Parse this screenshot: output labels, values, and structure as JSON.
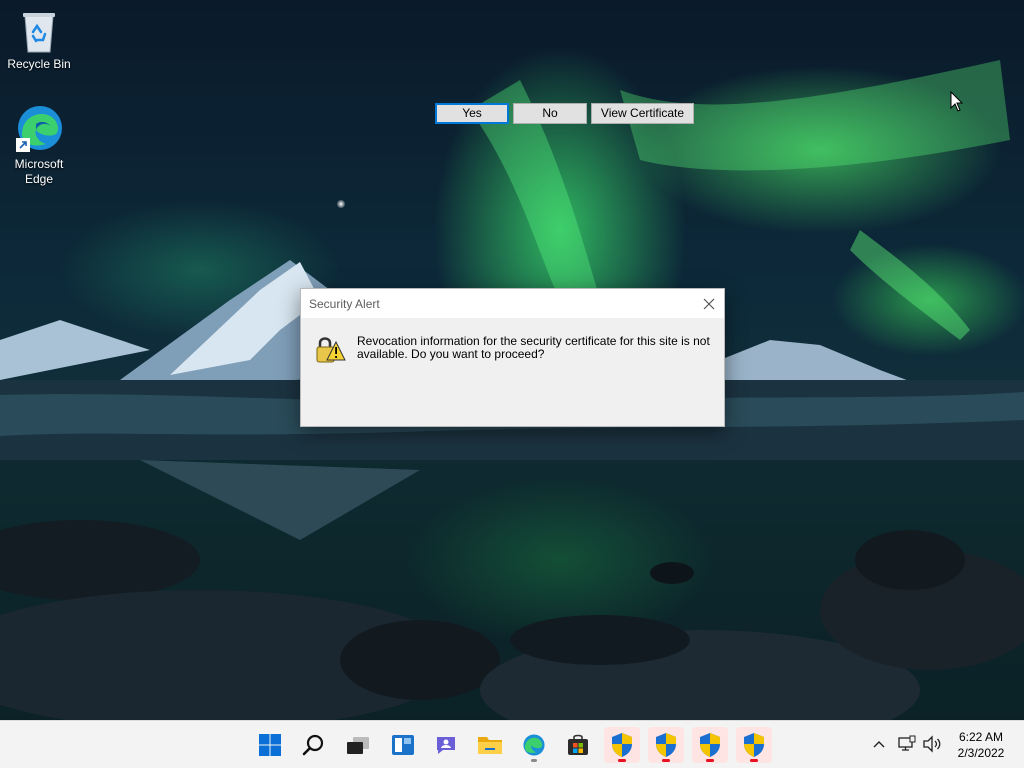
{
  "desktop": {
    "icons": [
      {
        "label": "Recycle Bin",
        "icon": "recycle-bin-icon"
      },
      {
        "label": "Microsoft Edge",
        "icon": "edge-icon"
      }
    ]
  },
  "dialog": {
    "title": "Security Alert",
    "message": "Revocation information for the security certificate for this site is not available. Do you want to proceed?",
    "buttons": {
      "yes": "Yes",
      "no": "No",
      "view": "View Certificate"
    },
    "icon": "security-warning-lock-icon"
  },
  "taskbar": {
    "apps": [
      {
        "name": "start",
        "icon": "windows-start-icon"
      },
      {
        "name": "search",
        "icon": "search-icon"
      },
      {
        "name": "task-view",
        "icon": "task-view-icon"
      },
      {
        "name": "widgets",
        "icon": "widgets-icon"
      },
      {
        "name": "teams-chat",
        "icon": "chat-icon"
      },
      {
        "name": "file-explorer",
        "icon": "folder-icon"
      },
      {
        "name": "edge",
        "icon": "edge-icon",
        "running": true
      },
      {
        "name": "store",
        "icon": "store-icon"
      },
      {
        "name": "uac-1",
        "icon": "shield-icon",
        "alert": true
      },
      {
        "name": "uac-2",
        "icon": "shield-icon",
        "alert": true
      },
      {
        "name": "uac-3",
        "icon": "shield-icon",
        "alert": true
      },
      {
        "name": "uac-4",
        "icon": "shield-icon",
        "alert": true
      }
    ],
    "tray": {
      "time": "6:22 AM",
      "date": "2/3/2022"
    }
  },
  "colors": {
    "accent": "#0078d7",
    "alert": "#e81123",
    "taskbar": "#f3f3f3"
  }
}
